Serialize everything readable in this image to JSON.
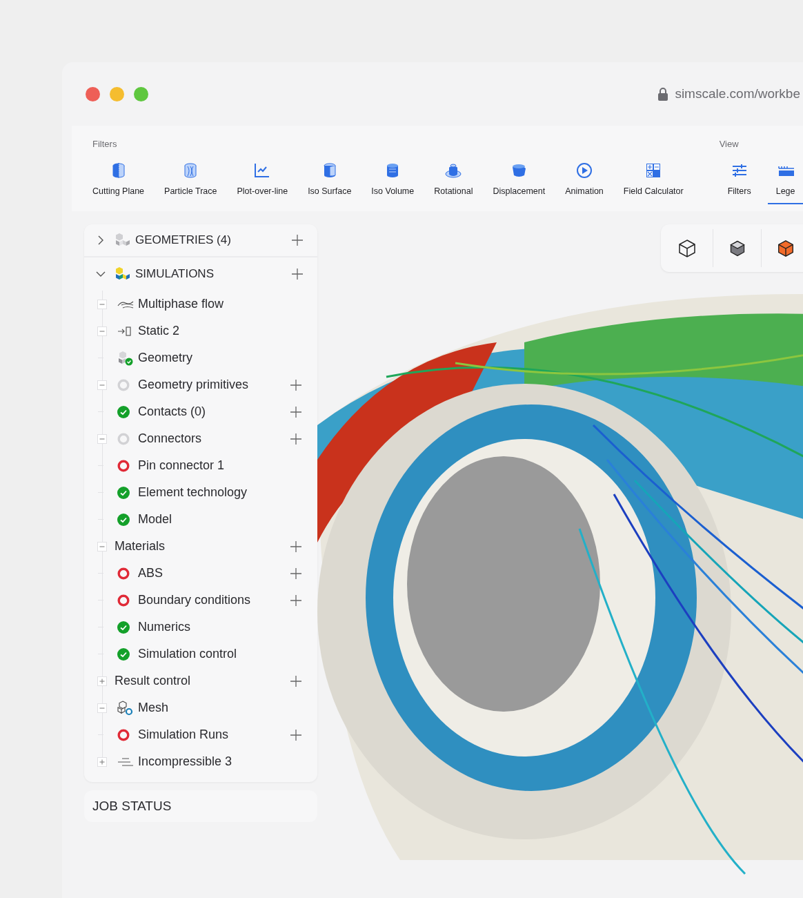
{
  "browser": {
    "address": "simscale.com/workbe"
  },
  "toolbar": {
    "filters_title": "Filters",
    "filters": [
      {
        "label": "Cutting Plane"
      },
      {
        "label": "Particle Trace"
      },
      {
        "label": "Plot-over-line"
      },
      {
        "label": "Iso Surface"
      },
      {
        "label": "Iso Volume"
      },
      {
        "label": "Rotational"
      },
      {
        "label": "Displacement"
      },
      {
        "label": "Animation"
      },
      {
        "label": "Field Calculator"
      }
    ],
    "view_title": "View",
    "view": [
      {
        "label": "Filters",
        "selected": false
      },
      {
        "label": "Lege",
        "selected": true
      }
    ]
  },
  "sidebar": {
    "sections": [
      {
        "label": "GEOMETRIES (4)",
        "expanded": false
      },
      {
        "label": "SIMULATIONS",
        "expanded": true
      }
    ],
    "tree": [
      {
        "kind": "flow",
        "label": "Multiphase flow",
        "expanded": true,
        "addable": false
      },
      {
        "kind": "static",
        "label": "Static 2",
        "expanded": true,
        "addable": false
      },
      {
        "kind": "geometry",
        "label": "Geometry",
        "addable": false
      },
      {
        "kind": "pending",
        "label": "Geometry primitives",
        "expanded": true,
        "addable": true
      },
      {
        "kind": "ok",
        "label": "Contacts (0)",
        "addable": true
      },
      {
        "kind": "pending",
        "label": "Connectors",
        "expanded": true,
        "addable": true
      },
      {
        "kind": "error",
        "label": "Pin connector 1",
        "addable": false
      },
      {
        "kind": "ok",
        "label": "Element technology",
        "addable": false
      },
      {
        "kind": "ok",
        "label": "Model",
        "addable": false
      },
      {
        "kind": "plain",
        "label": "Materials",
        "expanded": true,
        "addable": true
      },
      {
        "kind": "error",
        "label": "ABS",
        "addable": true
      },
      {
        "kind": "error",
        "label": "Boundary conditions",
        "addable": true
      },
      {
        "kind": "ok",
        "label": "Numerics",
        "addable": false
      },
      {
        "kind": "ok",
        "label": "Simulation control",
        "addable": false
      },
      {
        "kind": "plain",
        "label": "Result control",
        "expanded": false,
        "addable": true
      },
      {
        "kind": "mesh",
        "label": "Mesh",
        "expanded": true,
        "addable": false
      },
      {
        "kind": "error",
        "label": "Simulation Runs",
        "addable": true
      },
      {
        "kind": "incompressible",
        "label": "Incompressible 3",
        "expanded": false,
        "addable": false
      }
    ],
    "job_status": "JOB STATUS"
  }
}
